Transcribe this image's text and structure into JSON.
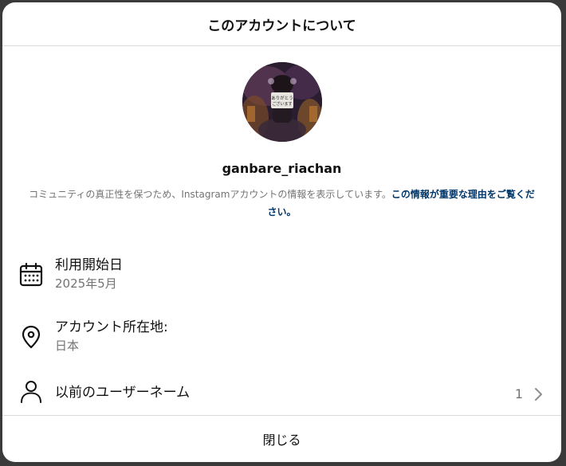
{
  "modal": {
    "title": "このアカウントについて"
  },
  "profile": {
    "username": "ganbare_riachan",
    "avatar_sign_text": "ありがとう ございます"
  },
  "description": {
    "text": "コミュニティの真正性を保つため、Instagramアカウントの情報を表示しています。",
    "link_text": "この情報が重要な理由をご覧ください。"
  },
  "info": {
    "joined": {
      "label": "利用開始日",
      "value": "2025年5月",
      "icon": "calendar-icon"
    },
    "location": {
      "label": "アカウント所在地:",
      "value": "日本",
      "icon": "location-pin-icon"
    },
    "former_usernames": {
      "label": "以前のユーザーネーム",
      "count": "1",
      "icon": "person-icon"
    }
  },
  "footer": {
    "close_label": "閉じる"
  },
  "colors": {
    "link": "#00376b",
    "secondary_text": "#737373",
    "divider": "#dbdbdb"
  }
}
